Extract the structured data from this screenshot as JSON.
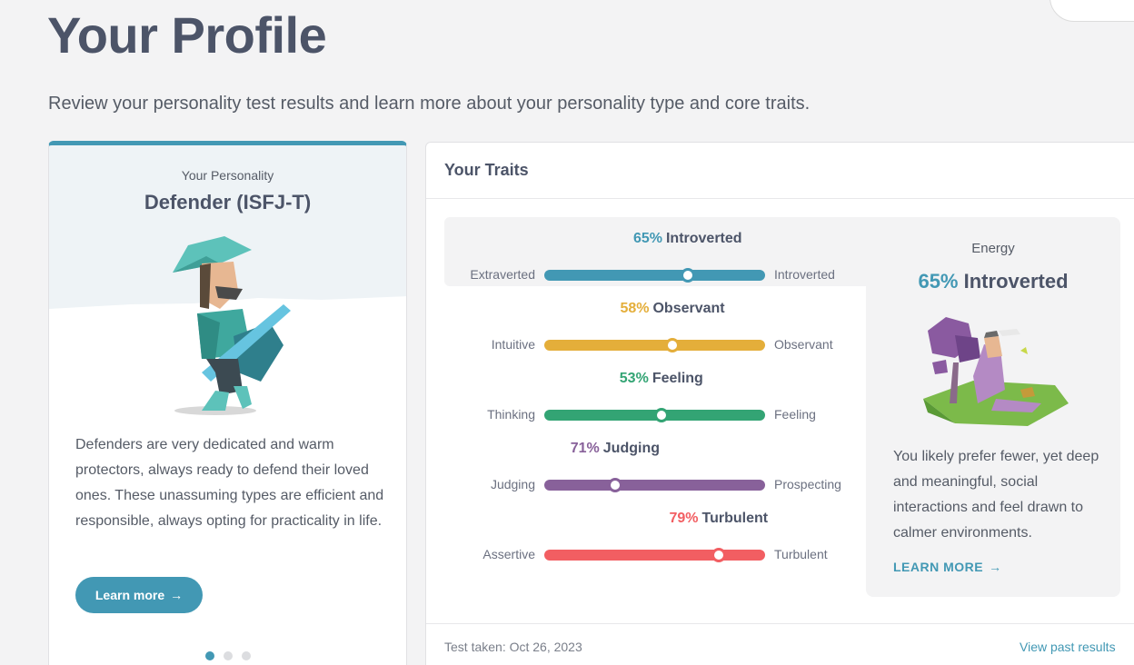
{
  "page": {
    "title": "Your Profile",
    "subtitle": "Review your personality test results and learn more about your personality type and core traits."
  },
  "personality_card": {
    "kicker": "Your Personality",
    "type": "Defender (ISFJ-T)",
    "description": "Defenders are very dedicated and warm protectors, always ready to defend their loved ones. These unassuming types are efficient and responsible, always opting for practicality in life.",
    "learn_more": "Learn more",
    "carousel": {
      "total": 3,
      "active_index": 0
    }
  },
  "traits": {
    "title": "Your Traits",
    "items": [
      {
        "percent": "65%",
        "label": "Introverted",
        "left": "Extraverted",
        "right": "Introverted",
        "color": "#4298b4",
        "value_from_left": 0.65,
        "highlighted": true
      },
      {
        "percent": "58%",
        "label": "Observant",
        "left": "Intuitive",
        "right": "Observant",
        "color": "#e4ae3a",
        "value_from_left": 0.58,
        "highlighted": false
      },
      {
        "percent": "53%",
        "label": "Feeling",
        "left": "Thinking",
        "right": "Feeling",
        "color": "#33a474",
        "value_from_left": 0.53,
        "highlighted": false
      },
      {
        "percent": "71%",
        "label": "Judging",
        "left": "Judging",
        "right": "Prospecting",
        "color": "#88619a",
        "value_from_left": 0.32,
        "highlighted": false
      },
      {
        "percent": "79%",
        "label": "Turbulent",
        "left": "Assertive",
        "right": "Turbulent",
        "color": "#f25e62",
        "value_from_left": 0.79,
        "highlighted": false
      }
    ]
  },
  "energy": {
    "kicker": "Energy",
    "percent": "65%",
    "label": "Introverted",
    "description": "You likely prefer fewer, yet deep and meaningful, social interactions and feel drawn to calmer environments.",
    "learn_more": "LEARN MORE"
  },
  "footer": {
    "test_taken": "Test taken: Oct 26, 2023",
    "past_results": "View past results"
  },
  "colors": {
    "accent": "#4298b4",
    "observant": "#e4ae3a",
    "feeling": "#33a474",
    "judging": "#88619a",
    "turbulent": "#f25e62"
  }
}
